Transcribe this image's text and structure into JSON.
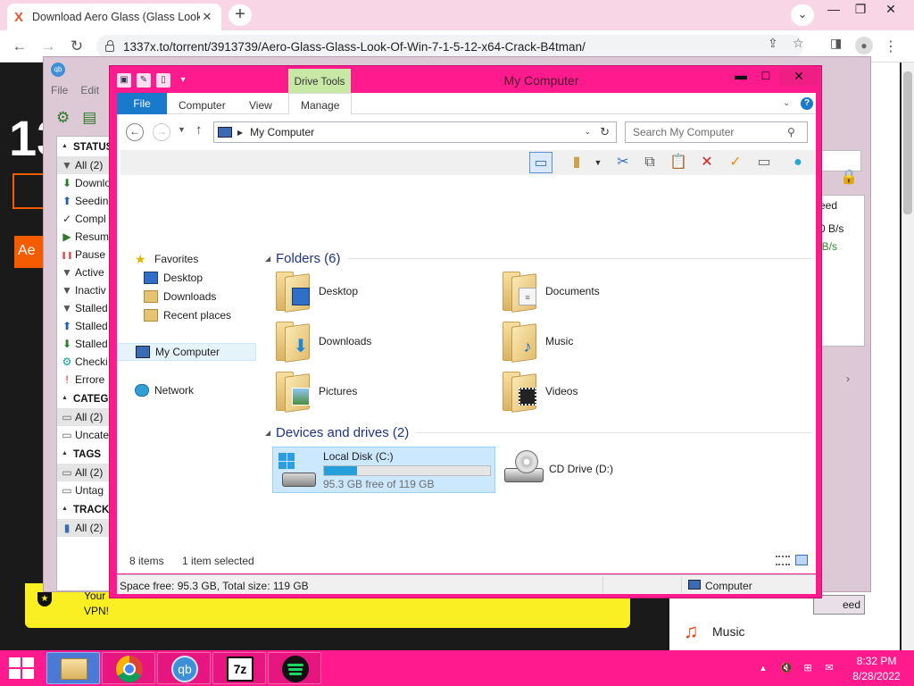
{
  "browser": {
    "tab_title": "Download Aero Glass (Glass Look",
    "tab_favicon": "X",
    "url": "1337x.to/torrent/3913739/Aero-Glass-Glass-Look-Of-Win-7-1-5-12-x64-Crack-B4tman/",
    "icons": [
      "back-arrow-icon",
      "forward-arrow-icon",
      "reload-icon",
      "lock-icon",
      "share-icon",
      "star-icon",
      "side-panel-icon",
      "profile-icon",
      "kebab-menu-icon"
    ]
  },
  "webpage": {
    "logo_partial": "13",
    "vpn_text": "Your VPN!",
    "sidebar_item": "Music",
    "brand_color": "#f55c00",
    "banner_color": "#f9ef22"
  },
  "qbittorrent": {
    "menu": [
      "File",
      "Edit"
    ],
    "sections": [
      {
        "title": "STATUS",
        "items": [
          {
            "icon": "filter-icon",
            "label": "All (2)"
          },
          {
            "icon": "download-arrow-icon",
            "label": "Downlo"
          },
          {
            "icon": "upload-arrow-icon",
            "label": "Seedin"
          },
          {
            "icon": "check-icon",
            "label": "Compl"
          },
          {
            "icon": "play-icon",
            "label": "Resum"
          },
          {
            "icon": "pause-icon",
            "label": "Pause"
          },
          {
            "icon": "filter-icon",
            "label": "Active"
          },
          {
            "icon": "filter-icon",
            "label": "Inactiv"
          },
          {
            "icon": "filter-icon",
            "label": "Stalled"
          },
          {
            "icon": "upload-arrow-icon",
            "label": "Stalled"
          },
          {
            "icon": "download-arrow-icon",
            "label": "Stalled"
          },
          {
            "icon": "gear-icon",
            "label": "Checki"
          },
          {
            "icon": "exclamation-icon",
            "label": "Errore"
          }
        ]
      },
      {
        "title": "CATEGO",
        "items": [
          {
            "icon": "folder-icon",
            "label": "All (2)"
          },
          {
            "icon": "folder-icon",
            "label": "Uncate"
          }
        ]
      },
      {
        "title": "TAGS",
        "items": [
          {
            "icon": "folder-icon",
            "label": "All (2)"
          },
          {
            "icon": "folder-icon",
            "label": "Untag"
          }
        ]
      },
      {
        "title": "TRACKE",
        "items": [
          {
            "icon": "tracker-icon",
            "label": "All (2)"
          }
        ]
      }
    ],
    "right_col_header": "eed",
    "speed_row1": "0 B/s",
    "speed_row2": "iB/s",
    "speed_button": "eed"
  },
  "explorer": {
    "title": "My Computer",
    "contextual_tab": "Drive Tools",
    "ribbon_tabs": {
      "file": "File",
      "computer": "Computer",
      "view": "View",
      "manage": "Manage"
    },
    "address": "My Computer",
    "search_placeholder": "Search My Computer",
    "nav": {
      "favorites": "Favorites",
      "desktop": "Desktop",
      "downloads": "Downloads",
      "recent": "Recent places",
      "my_computer": "My Computer",
      "network": "Network"
    },
    "folders_header": "Folders (6)",
    "folders": [
      {
        "name": "Desktop",
        "overlay": "desktop-overlay-icon"
      },
      {
        "name": "Documents",
        "overlay": "document-overlay-icon"
      },
      {
        "name": "Downloads",
        "overlay": "download-arrow-icon"
      },
      {
        "name": "Music",
        "overlay": "music-note-icon"
      },
      {
        "name": "Pictures",
        "overlay": "picture-overlay-icon"
      },
      {
        "name": "Videos",
        "overlay": "film-strip-icon"
      }
    ],
    "devices_header": "Devices and drives (2)",
    "drive_c": {
      "name": "Local Disk (C:)",
      "free_text": "95.3 GB free of 119 GB",
      "used_fraction": 0.2
    },
    "drive_d": {
      "name": "CD Drive (D:)"
    },
    "status_count": "8 items",
    "status_selected": "1 item selected",
    "info_space": "Space free: 95.3 GB, Total size: 119 GB",
    "info_location": "Computer",
    "accent_color": "#ff1b8d",
    "ribbon_color": "#1979ca"
  },
  "taskbar": {
    "apps": [
      "file-explorer-icon",
      "chrome-icon",
      "qbittorrent-icon",
      "7zip-icon",
      "spotify-icon"
    ],
    "qbt_label": "qb",
    "sevenzip_label": "7z",
    "time": "8:32 PM",
    "date": "8/28/2022",
    "color": "#ff1b8d"
  }
}
